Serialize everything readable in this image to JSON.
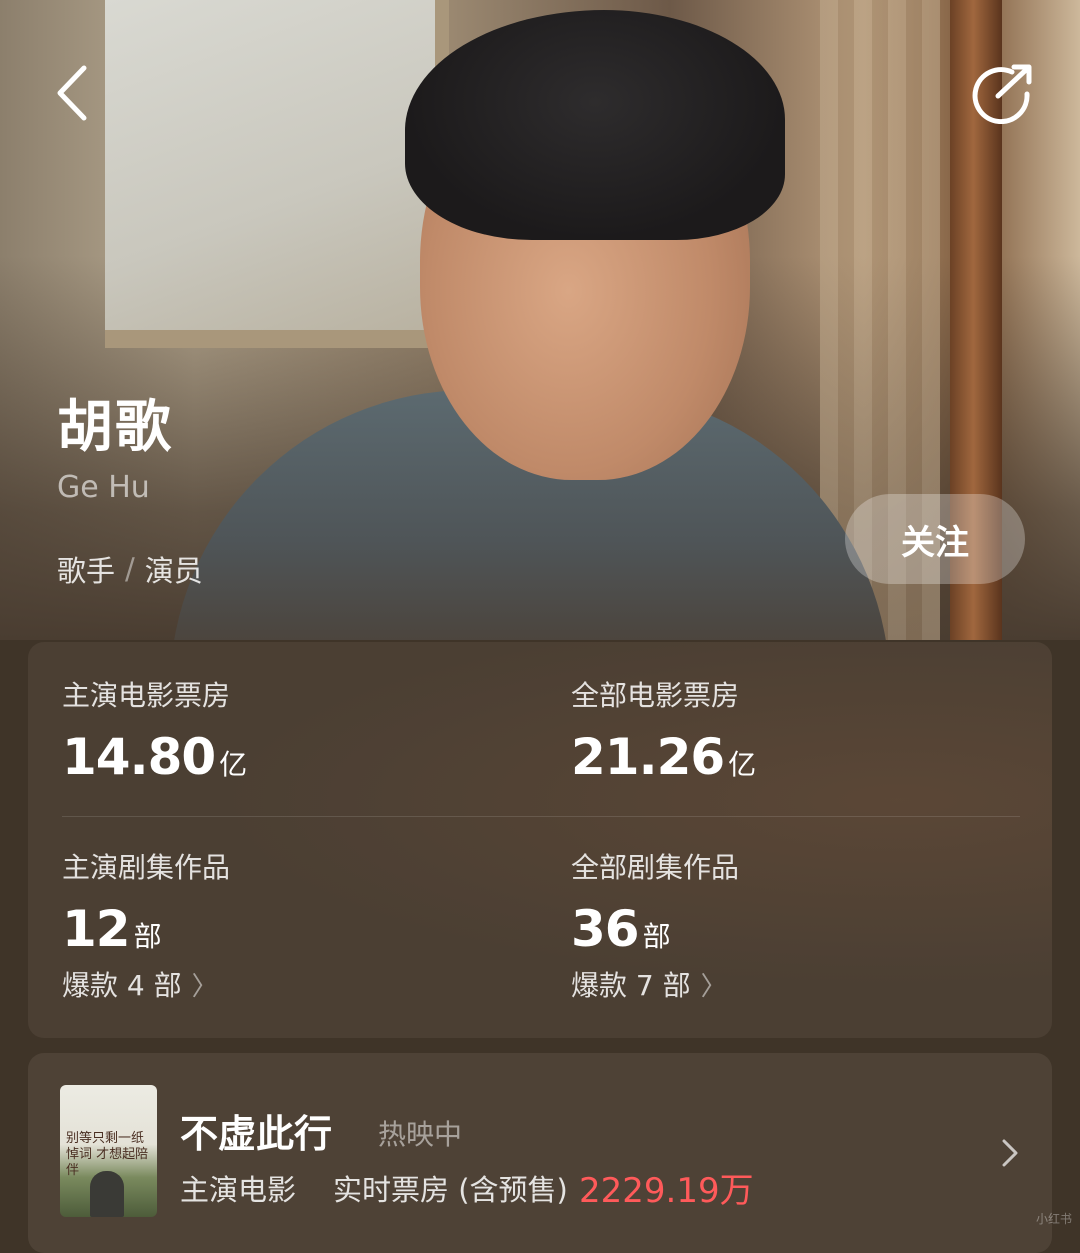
{
  "profile": {
    "name": "胡歌",
    "name_en": "Ge Hu",
    "roles": [
      "歌手",
      "演员"
    ],
    "role_separator": "/",
    "follow_label": "关注"
  },
  "stats": {
    "lead_film_box_office": {
      "label": "主演电影票房",
      "value": "14.80",
      "unit": "亿"
    },
    "all_film_box_office": {
      "label": "全部电影票房",
      "value": "21.26",
      "unit": "亿"
    },
    "lead_series": {
      "label": "主演剧集作品",
      "value": "12",
      "unit": "部",
      "hits": "爆款 4 部"
    },
    "all_series": {
      "label": "全部剧集作品",
      "value": "36",
      "unit": "部",
      "hits": "爆款 7 部"
    }
  },
  "movie": {
    "title": "不虚此行",
    "status": "热映中",
    "role": "主演电影",
    "box_office_label": "实时票房 (含预售)",
    "box_office_value": "2229.19万",
    "poster_text": "别等只剩一纸悼词 才想起陪伴",
    "value_color": "#ff5a5a"
  },
  "watermark": "小红书",
  "icons": {
    "back": "chevron-left-icon",
    "share": "share-icon",
    "chevron": "chevron-right-icon"
  }
}
